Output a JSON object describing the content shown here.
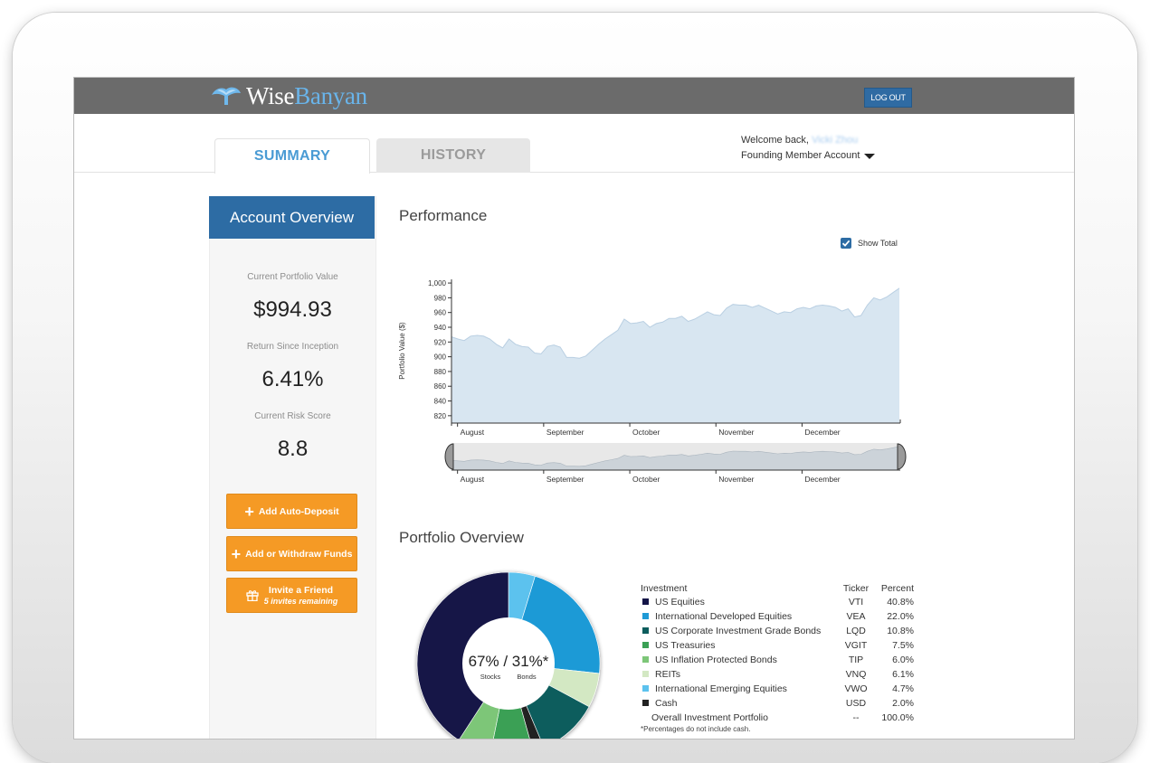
{
  "app": {
    "logo": {
      "part1": "Wise",
      "part2": "Banyan"
    },
    "logout_label": "LOG OUT"
  },
  "tabs": [
    {
      "label": "SUMMARY",
      "active": true
    },
    {
      "label": "HISTORY",
      "active": false
    }
  ],
  "welcome": {
    "prefix": "Welcome back,",
    "name": "Vicki Zhou",
    "account": "Founding Member Account"
  },
  "sidebar": {
    "title": "Account Overview",
    "stats": [
      {
        "label": "Current Portfolio Value",
        "value": "$994.93"
      },
      {
        "label": "Return Since Inception",
        "value": "6.41%"
      },
      {
        "label": "Current Risk Score",
        "value": "8.8"
      }
    ],
    "buttons": {
      "auto_deposit": "Add Auto-Deposit",
      "add_withdraw": "Add or Withdraw Funds",
      "invite": "Invite a Friend",
      "invite_sub": "5 invites remaining"
    }
  },
  "performance": {
    "title": "Performance",
    "show_total_label": "Show Total",
    "show_total_checked": true
  },
  "chart_data": {
    "type": "area",
    "ylabel": "Portfolio Value ($)",
    "xlabel": "",
    "ylim": [
      810,
      1005
    ],
    "yticks": [
      "1,000",
      "980",
      "960",
      "940",
      "920",
      "900",
      "880",
      "860",
      "840",
      "820"
    ],
    "xticks": [
      "August",
      "September",
      "October",
      "November",
      "December"
    ],
    "values": [
      927,
      924,
      922,
      928,
      929,
      928,
      924,
      917,
      912,
      924,
      917,
      914,
      913,
      905,
      904,
      914,
      916,
      913,
      899,
      899,
      898,
      901,
      909,
      917,
      924,
      930,
      936,
      951,
      945,
      946,
      948,
      940,
      945,
      947,
      952,
      952,
      955,
      948,
      951,
      956,
      961,
      957,
      956,
      966,
      971,
      970,
      970,
      967,
      970,
      966,
      962,
      958,
      961,
      960,
      965,
      967,
      965,
      969,
      970,
      969,
      967,
      962,
      965,
      954,
      956,
      970,
      980,
      977,
      981,
      987,
      993
    ],
    "colors": {
      "area": "#d8e6f1",
      "line": "#b9cfe2",
      "navigator": "#ccd3d9"
    }
  },
  "portfolio": {
    "title": "Portfolio Overview",
    "center_label": "67% / 31%*",
    "center_sub_left": "Stocks",
    "center_sub_right": "Bonds",
    "headers": {
      "investment": "Investment",
      "ticker": "Ticker",
      "percent": "Percent"
    },
    "holdings": [
      {
        "name": "US Equities",
        "ticker": "VTI",
        "percent": "40.8%",
        "value": 40.8,
        "color": "#131447"
      },
      {
        "name": "International Developed Equities",
        "ticker": "VEA",
        "percent": "22.0%",
        "value": 22.0,
        "color": "#1f9ad6"
      },
      {
        "name": "US Corporate Investment Grade Bonds",
        "ticker": "LQD",
        "percent": "10.8%",
        "value": 10.8,
        "color": "#0c5d5d"
      },
      {
        "name": "US Treasuries",
        "ticker": "VGIT",
        "percent": "7.5%",
        "value": 7.5,
        "color": "#3aa055"
      },
      {
        "name": "US Inflation Protected Bonds",
        "ticker": "TIP",
        "percent": "6.0%",
        "value": 6.0,
        "color": "#7dc678"
      },
      {
        "name": "REITs",
        "ticker": "VNQ",
        "percent": "6.1%",
        "value": 6.1,
        "color": "#d3e8c3"
      },
      {
        "name": "International Emerging Equities",
        "ticker": "VWO",
        "percent": "4.7%",
        "value": 4.7,
        "color": "#5cc2ee"
      },
      {
        "name": "Cash",
        "ticker": "USD",
        "percent": "2.0%",
        "value": 2.0,
        "color": "#222222"
      }
    ],
    "total": {
      "name": "Overall Investment Portfolio",
      "ticker": "--",
      "percent": "100.0%"
    },
    "note": "*Percentages do not include cash."
  }
}
